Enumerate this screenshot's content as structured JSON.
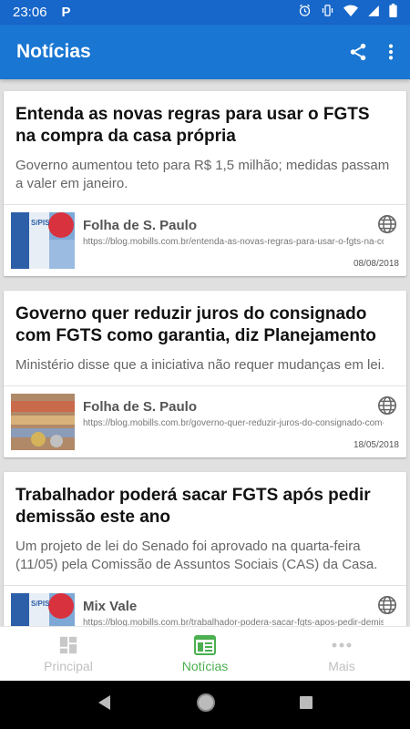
{
  "status": {
    "time": "23:06",
    "app_letter": "P"
  },
  "app_bar": {
    "title": "Notícias",
    "accent": "#1976d2"
  },
  "articles": [
    {
      "title": "Entenda as novas regras para usar o FGTS na compra da casa própria",
      "summary": "Governo aumentou teto para R$ 1,5 milhão; medidas passam a valer em janeiro.",
      "source": "Folha de S. Paulo",
      "url": "https://blog.mobills.com.br/entenda-as-novas-regras-para-usar-o-fgts-na-compra-da-casa-propria",
      "date": "08/08/2018"
    },
    {
      "title": "Governo quer reduzir juros do consignado com FGTS como garantia, diz Planejamento",
      "summary": "Ministério disse que a iniciativa não requer mudanças em lei.",
      "source": "Folha de S. Paulo",
      "url": "https://blog.mobills.com.br/governo-quer-reduzir-juros-do-consignado-com-fgts",
      "date": "18/05/2018"
    },
    {
      "title": "Trabalhador poderá sacar FGTS após pedir demissão este ano",
      "summary": "Um projeto de lei do Senado foi aprovado na quarta-feira (11/05) pela Comissão de Assuntos Sociais (CAS) da Casa.",
      "source": "Mix Vale",
      "url": "https://blog.mobills.com.br/trabalhador-podera-sacar-fgts-apos-pedir-demissao",
      "date": ""
    }
  ],
  "bottom_nav": {
    "items": [
      {
        "label": "Principal",
        "icon": "dashboard-icon"
      },
      {
        "label": "Notícias",
        "icon": "news-icon"
      },
      {
        "label": "Mais",
        "icon": "more-horiz-icon"
      }
    ],
    "active_color": "#4caf50"
  }
}
